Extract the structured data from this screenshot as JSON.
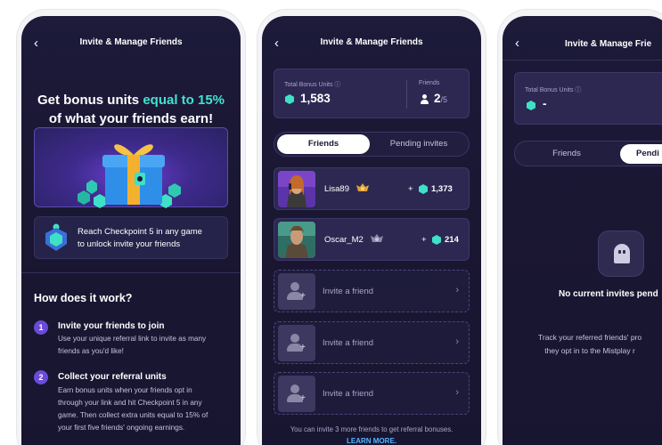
{
  "screen1": {
    "header": {
      "back": "‹",
      "title": "Invite & Manage Friends"
    },
    "headline": {
      "part1": "Get bonus units ",
      "highlight": "equal to 15%",
      "part2": "of what your friends earn!"
    },
    "checkpoint": {
      "line1": "Reach Checkpoint 5 in any game",
      "line2": "to unlock invite your friends"
    },
    "how_title": "How does it work?",
    "steps": [
      {
        "num": "1",
        "title": "Invite your friends to join",
        "lines": [
          "Use your unique referral link to invite as many",
          "friends as you'd like!"
        ]
      },
      {
        "num": "2",
        "title": "Collect your referral units",
        "lines": [
          "Earn bonus units when your friends opt in",
          "through your link and hit Checkpoint 5 in any",
          "game. Then collect extra units equal to 15% of",
          "your first five friends' ongoing earnings."
        ]
      }
    ]
  },
  "screen2": {
    "header": {
      "back": "‹",
      "title": "Invite & Manage Friends"
    },
    "stats": {
      "total_label": "Total Bonus Units ⓘ",
      "total_value": "1,583",
      "friends_label": "Friends",
      "friends_count": "2",
      "friends_max": "/5"
    },
    "tabs": [
      "Friends",
      "Pending invites"
    ],
    "friends": [
      {
        "name": "Lisa89",
        "plus": "+",
        "value": "1,373",
        "badge_color": "#d99a2b"
      },
      {
        "name": "Oscar_M2",
        "plus": "+",
        "value": "214",
        "badge_color": "#8d8aa8"
      }
    ],
    "invite_label": "Invite a friend",
    "chevron": "›",
    "footnote": "You can invite 3 more friends to get referral bonuses.",
    "learn_more": "LEARN MORE."
  },
  "screen3": {
    "header": {
      "back": "‹",
      "title": "Invite & Manage Frie"
    },
    "stats": {
      "total_label": "Total Bonus Units ⓘ",
      "total_value": "-"
    },
    "tabs": [
      "Friends",
      "Pendi"
    ],
    "empty_title": "No current invites pend",
    "empty_desc": [
      "Track your referred friends' pro",
      "they opt in to the Mistplay r"
    ]
  },
  "colors": {
    "accent_teal": "#41e3cf",
    "bg": "#1b1838",
    "step_purple": "#6a4bd8",
    "link_blue": "#58b4ff"
  }
}
